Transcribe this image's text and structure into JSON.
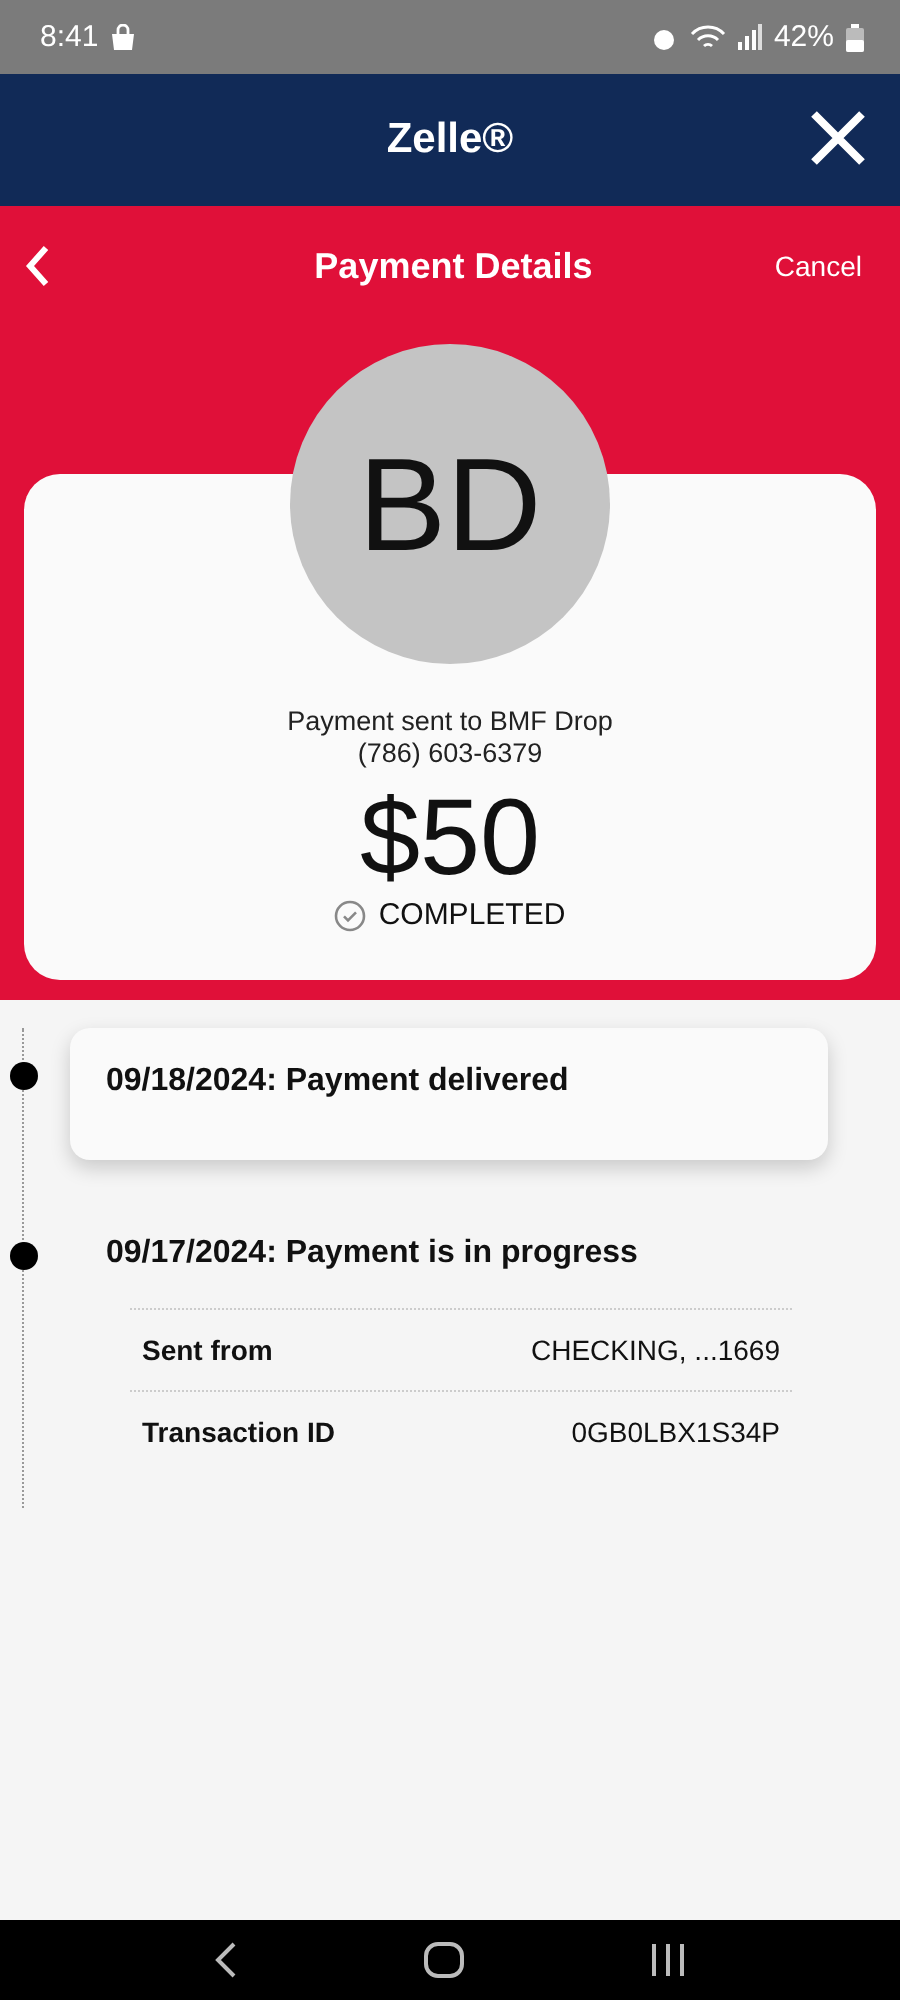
{
  "status_bar": {
    "time": "8:41",
    "battery": "42%"
  },
  "app_header": {
    "title": "Zelle®"
  },
  "nav": {
    "title": "Payment Details",
    "action": "Cancel"
  },
  "payment": {
    "initials": "BD",
    "recipient": "Payment sent to BMF Drop",
    "phone": "(786) 603-6379",
    "amount": "$50",
    "status": "COMPLETED"
  },
  "timeline": [
    {
      "text": "09/18/2024: Payment delivered",
      "selected": true
    },
    {
      "text": "09/17/2024: Payment is in progress",
      "selected": false,
      "details": [
        {
          "label": "Sent from",
          "value": "CHECKING, ...1669"
        },
        {
          "label": "Transaction ID",
          "value": "0GB0LBX1S34P"
        }
      ]
    }
  ]
}
